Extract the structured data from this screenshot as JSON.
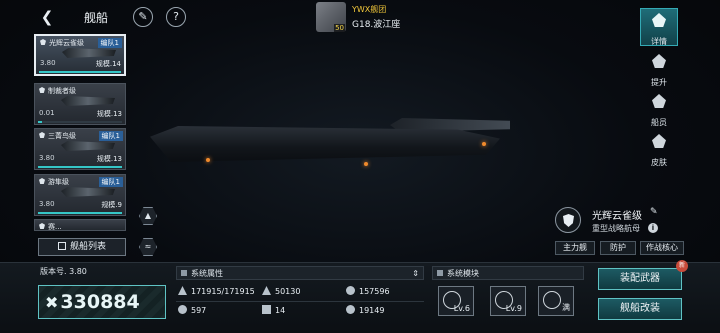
{
  "header": {
    "title": "舰船"
  },
  "fleet": {
    "name": "YWX舰团",
    "location": "G18.波江座",
    "level": "50"
  },
  "ships": [
    {
      "class": "光辉云雀级",
      "team": "编队1",
      "cost": "3.80",
      "scale": "规模.14",
      "bar": 1.0
    },
    {
      "class": "制裁者级",
      "team": "",
      "cost": "0.01",
      "scale": "规模.13",
      "bar": 0.05
    },
    {
      "class": "三菁鸟级",
      "team": "编队1",
      "cost": "3.80",
      "scale": "规模.13",
      "bar": 1.0
    },
    {
      "class": "游隼级",
      "team": "编队1",
      "cost": "3.80",
      "scale": "规模.9",
      "bar": 1.0
    },
    {
      "class": "赛...",
      "team": "",
      "cost": "",
      "scale": "",
      "bar": 0
    }
  ],
  "list_button": "舰船列表",
  "rail": [
    {
      "label": "详情",
      "icon": "details-icon"
    },
    {
      "label": "提升",
      "icon": "upgrade-icon"
    },
    {
      "label": "船员",
      "icon": "crew-icon"
    },
    {
      "label": "皮肤",
      "icon": "skin-icon"
    }
  ],
  "ship_info": {
    "name": "光辉云雀级",
    "type": "重型战略航母",
    "tags": [
      "主力舰",
      "防护",
      "作战核心"
    ]
  },
  "bottom": {
    "version": "版本号. 3.80",
    "power": "330884",
    "system_attr_title": "系统属性",
    "stats": {
      "hp": "171915/171915",
      "armor": "50130",
      "shield": "157596",
      "energy": "597",
      "speed": "14",
      "firepower": "19149"
    },
    "system_module_title": "系统模块",
    "modules": [
      "Lv.6",
      "Lv.9",
      "满"
    ],
    "btn_weapons": "装配武器",
    "btn_modify": "舰船改装",
    "new_badge": "新"
  }
}
